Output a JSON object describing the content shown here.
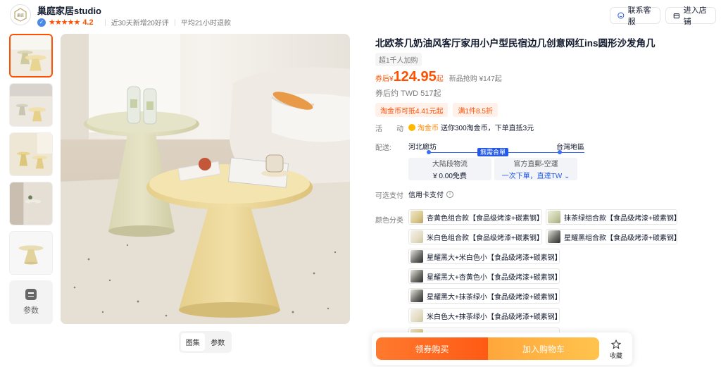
{
  "shop": {
    "name": "巢庭家居studio",
    "rating": "4.2",
    "stats": "近30天新增20好评",
    "reply": "平均21小时退款",
    "service_btn": "联系客服",
    "store_btn": "进入店铺"
  },
  "gallery": {
    "params_label": "参数",
    "tabs": [
      "图集",
      "参数"
    ]
  },
  "product": {
    "title": "北欧茶几奶油风客厅家用小户型民宿边几创意网红ins圆形沙发角几",
    "hot_tag": "超1千人加购",
    "price_prefix": "券后",
    "price_currency": "¥",
    "price_value": "124.95",
    "price_suffix": "起",
    "price_note": "新品抢购 ¥147起",
    "price_twd": "券后约 TWD 517起",
    "promos": [
      "淘金币可抵4.41元起",
      "满1件8.5折"
    ]
  },
  "activity": {
    "label": "活　　动",
    "coin_name": "淘金币",
    "text": "送你300淘金币，下单直抵3元"
  },
  "shipping": {
    "label": "配送:",
    "from": "河北廊坊",
    "to": "台灣地區",
    "badge": "無需合單",
    "box1_title": "大陆段物流",
    "box1_value": "¥ 0.00免费",
    "box2_title": "官方直郵-空運",
    "box2_value_a": "一次下單，",
    "box2_value_b": "直達TW"
  },
  "payment": {
    "label": "可选支付",
    "method": "信用卡支付"
  },
  "options": {
    "label": "颜色分类",
    "items": [
      {
        "label": "杏黄色组合款【食品级烤漆+碳素钢】",
        "tone": "yellow"
      },
      {
        "label": "抹茶绿组合款【食品级烤漆+碳素钢】",
        "tone": "green"
      },
      {
        "label": "米白色组合款【食品级烤漆+碳素钢】",
        "tone": "white"
      },
      {
        "label": "星耀黑组合款【食品级烤漆+碳素钢】",
        "tone": "dark"
      },
      {
        "label": "星耀黑大+米白色小【食品级烤漆+碳素钢】",
        "tone": "dark"
      },
      {
        "label": "星耀黑大+杏黄色小【食品级烤漆+碳素钢】",
        "tone": "dark"
      },
      {
        "label": "星耀黑大+抹茶绿小【食品级烤漆+碳素钢】",
        "tone": "dark"
      },
      {
        "label": "米白色大+抹茶绿小【食品级烤漆+碳素钢】",
        "tone": "white"
      }
    ]
  },
  "actions": {
    "coupon_buy": "领券购买",
    "add_cart": "加入购物车",
    "favorite": "收藏"
  },
  "colors": {
    "accent": "#ff5000",
    "link_blue": "#2459e6"
  }
}
